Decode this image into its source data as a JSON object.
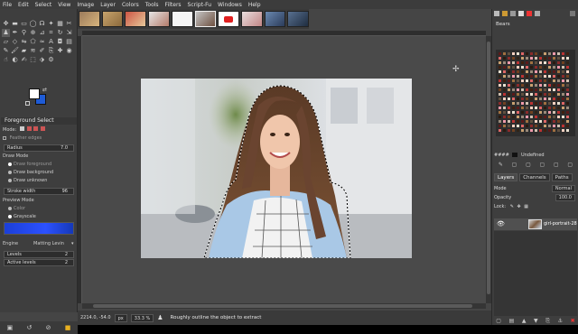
{
  "menu": [
    "File",
    "Edit",
    "Select",
    "View",
    "Image",
    "Layer",
    "Colors",
    "Tools",
    "Filters",
    "Script-Fu",
    "Windows",
    "Help"
  ],
  "tool_options": {
    "title": "Foreground Select",
    "mode_label": "Mode:",
    "feather_label": "Feather edges",
    "radius_label": "Radius",
    "radius_value": "7.0",
    "draw_mode_label": "Draw Mode",
    "draw_modes": [
      "Draw foreground",
      "Draw background",
      "Draw unknown"
    ],
    "stroke_label": "Stroke width",
    "stroke_value": "96",
    "preview_label": "Preview Mode",
    "preview_modes": [
      "Color",
      "Grayscale"
    ],
    "engine_label": "Engine",
    "engine_value": "Matting Levin",
    "levels_label": "Levels",
    "levels_value": "2",
    "active_levels_label": "Active levels",
    "active_levels_value": "2"
  },
  "status": {
    "coords": "2214.0, -54.0",
    "unit": "px",
    "zoom": "33.3 %",
    "hint": "Roughly outline the object to extract"
  },
  "dock": {
    "brushes_title": "Bears",
    "palette_name": "Undefined",
    "palette_prefix": "####",
    "tabs": [
      "Layers",
      "Channels",
      "Paths"
    ],
    "mode_label": "Mode",
    "mode_value": "Normal",
    "opacity_label": "Opacity",
    "opacity_value": "100.0",
    "lock_label": "Lock:",
    "layer_name": "girl-portrait-28"
  },
  "colors": {
    "foreground": "#ffffff",
    "background": "#1e5bd6"
  }
}
